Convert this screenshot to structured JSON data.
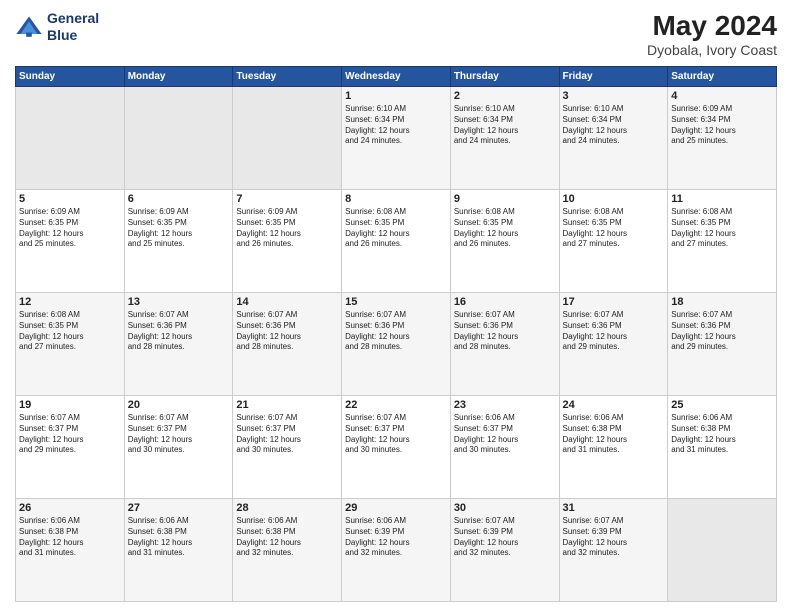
{
  "logo": {
    "line1": "General",
    "line2": "Blue"
  },
  "title": "May 2024",
  "location": "Dyobala, Ivory Coast",
  "days_of_week": [
    "Sunday",
    "Monday",
    "Tuesday",
    "Wednesday",
    "Thursday",
    "Friday",
    "Saturday"
  ],
  "weeks": [
    [
      {
        "day": "",
        "info": ""
      },
      {
        "day": "",
        "info": ""
      },
      {
        "day": "",
        "info": ""
      },
      {
        "day": "1",
        "info": "Sunrise: 6:10 AM\nSunset: 6:34 PM\nDaylight: 12 hours\nand 24 minutes."
      },
      {
        "day": "2",
        "info": "Sunrise: 6:10 AM\nSunset: 6:34 PM\nDaylight: 12 hours\nand 24 minutes."
      },
      {
        "day": "3",
        "info": "Sunrise: 6:10 AM\nSunset: 6:34 PM\nDaylight: 12 hours\nand 24 minutes."
      },
      {
        "day": "4",
        "info": "Sunrise: 6:09 AM\nSunset: 6:34 PM\nDaylight: 12 hours\nand 25 minutes."
      }
    ],
    [
      {
        "day": "5",
        "info": "Sunrise: 6:09 AM\nSunset: 6:35 PM\nDaylight: 12 hours\nand 25 minutes."
      },
      {
        "day": "6",
        "info": "Sunrise: 6:09 AM\nSunset: 6:35 PM\nDaylight: 12 hours\nand 25 minutes."
      },
      {
        "day": "7",
        "info": "Sunrise: 6:09 AM\nSunset: 6:35 PM\nDaylight: 12 hours\nand 26 minutes."
      },
      {
        "day": "8",
        "info": "Sunrise: 6:08 AM\nSunset: 6:35 PM\nDaylight: 12 hours\nand 26 minutes."
      },
      {
        "day": "9",
        "info": "Sunrise: 6:08 AM\nSunset: 6:35 PM\nDaylight: 12 hours\nand 26 minutes."
      },
      {
        "day": "10",
        "info": "Sunrise: 6:08 AM\nSunset: 6:35 PM\nDaylight: 12 hours\nand 27 minutes."
      },
      {
        "day": "11",
        "info": "Sunrise: 6:08 AM\nSunset: 6:35 PM\nDaylight: 12 hours\nand 27 minutes."
      }
    ],
    [
      {
        "day": "12",
        "info": "Sunrise: 6:08 AM\nSunset: 6:35 PM\nDaylight: 12 hours\nand 27 minutes."
      },
      {
        "day": "13",
        "info": "Sunrise: 6:07 AM\nSunset: 6:36 PM\nDaylight: 12 hours\nand 28 minutes."
      },
      {
        "day": "14",
        "info": "Sunrise: 6:07 AM\nSunset: 6:36 PM\nDaylight: 12 hours\nand 28 minutes."
      },
      {
        "day": "15",
        "info": "Sunrise: 6:07 AM\nSunset: 6:36 PM\nDaylight: 12 hours\nand 28 minutes."
      },
      {
        "day": "16",
        "info": "Sunrise: 6:07 AM\nSunset: 6:36 PM\nDaylight: 12 hours\nand 28 minutes."
      },
      {
        "day": "17",
        "info": "Sunrise: 6:07 AM\nSunset: 6:36 PM\nDaylight: 12 hours\nand 29 minutes."
      },
      {
        "day": "18",
        "info": "Sunrise: 6:07 AM\nSunset: 6:36 PM\nDaylight: 12 hours\nand 29 minutes."
      }
    ],
    [
      {
        "day": "19",
        "info": "Sunrise: 6:07 AM\nSunset: 6:37 PM\nDaylight: 12 hours\nand 29 minutes."
      },
      {
        "day": "20",
        "info": "Sunrise: 6:07 AM\nSunset: 6:37 PM\nDaylight: 12 hours\nand 30 minutes."
      },
      {
        "day": "21",
        "info": "Sunrise: 6:07 AM\nSunset: 6:37 PM\nDaylight: 12 hours\nand 30 minutes."
      },
      {
        "day": "22",
        "info": "Sunrise: 6:07 AM\nSunset: 6:37 PM\nDaylight: 12 hours\nand 30 minutes."
      },
      {
        "day": "23",
        "info": "Sunrise: 6:06 AM\nSunset: 6:37 PM\nDaylight: 12 hours\nand 30 minutes."
      },
      {
        "day": "24",
        "info": "Sunrise: 6:06 AM\nSunset: 6:38 PM\nDaylight: 12 hours\nand 31 minutes."
      },
      {
        "day": "25",
        "info": "Sunrise: 6:06 AM\nSunset: 6:38 PM\nDaylight: 12 hours\nand 31 minutes."
      }
    ],
    [
      {
        "day": "26",
        "info": "Sunrise: 6:06 AM\nSunset: 6:38 PM\nDaylight: 12 hours\nand 31 minutes."
      },
      {
        "day": "27",
        "info": "Sunrise: 6:06 AM\nSunset: 6:38 PM\nDaylight: 12 hours\nand 31 minutes."
      },
      {
        "day": "28",
        "info": "Sunrise: 6:06 AM\nSunset: 6:38 PM\nDaylight: 12 hours\nand 32 minutes."
      },
      {
        "day": "29",
        "info": "Sunrise: 6:06 AM\nSunset: 6:39 PM\nDaylight: 12 hours\nand 32 minutes."
      },
      {
        "day": "30",
        "info": "Sunrise: 6:07 AM\nSunset: 6:39 PM\nDaylight: 12 hours\nand 32 minutes."
      },
      {
        "day": "31",
        "info": "Sunrise: 6:07 AM\nSunset: 6:39 PM\nDaylight: 12 hours\nand 32 minutes."
      },
      {
        "day": "",
        "info": ""
      }
    ]
  ]
}
